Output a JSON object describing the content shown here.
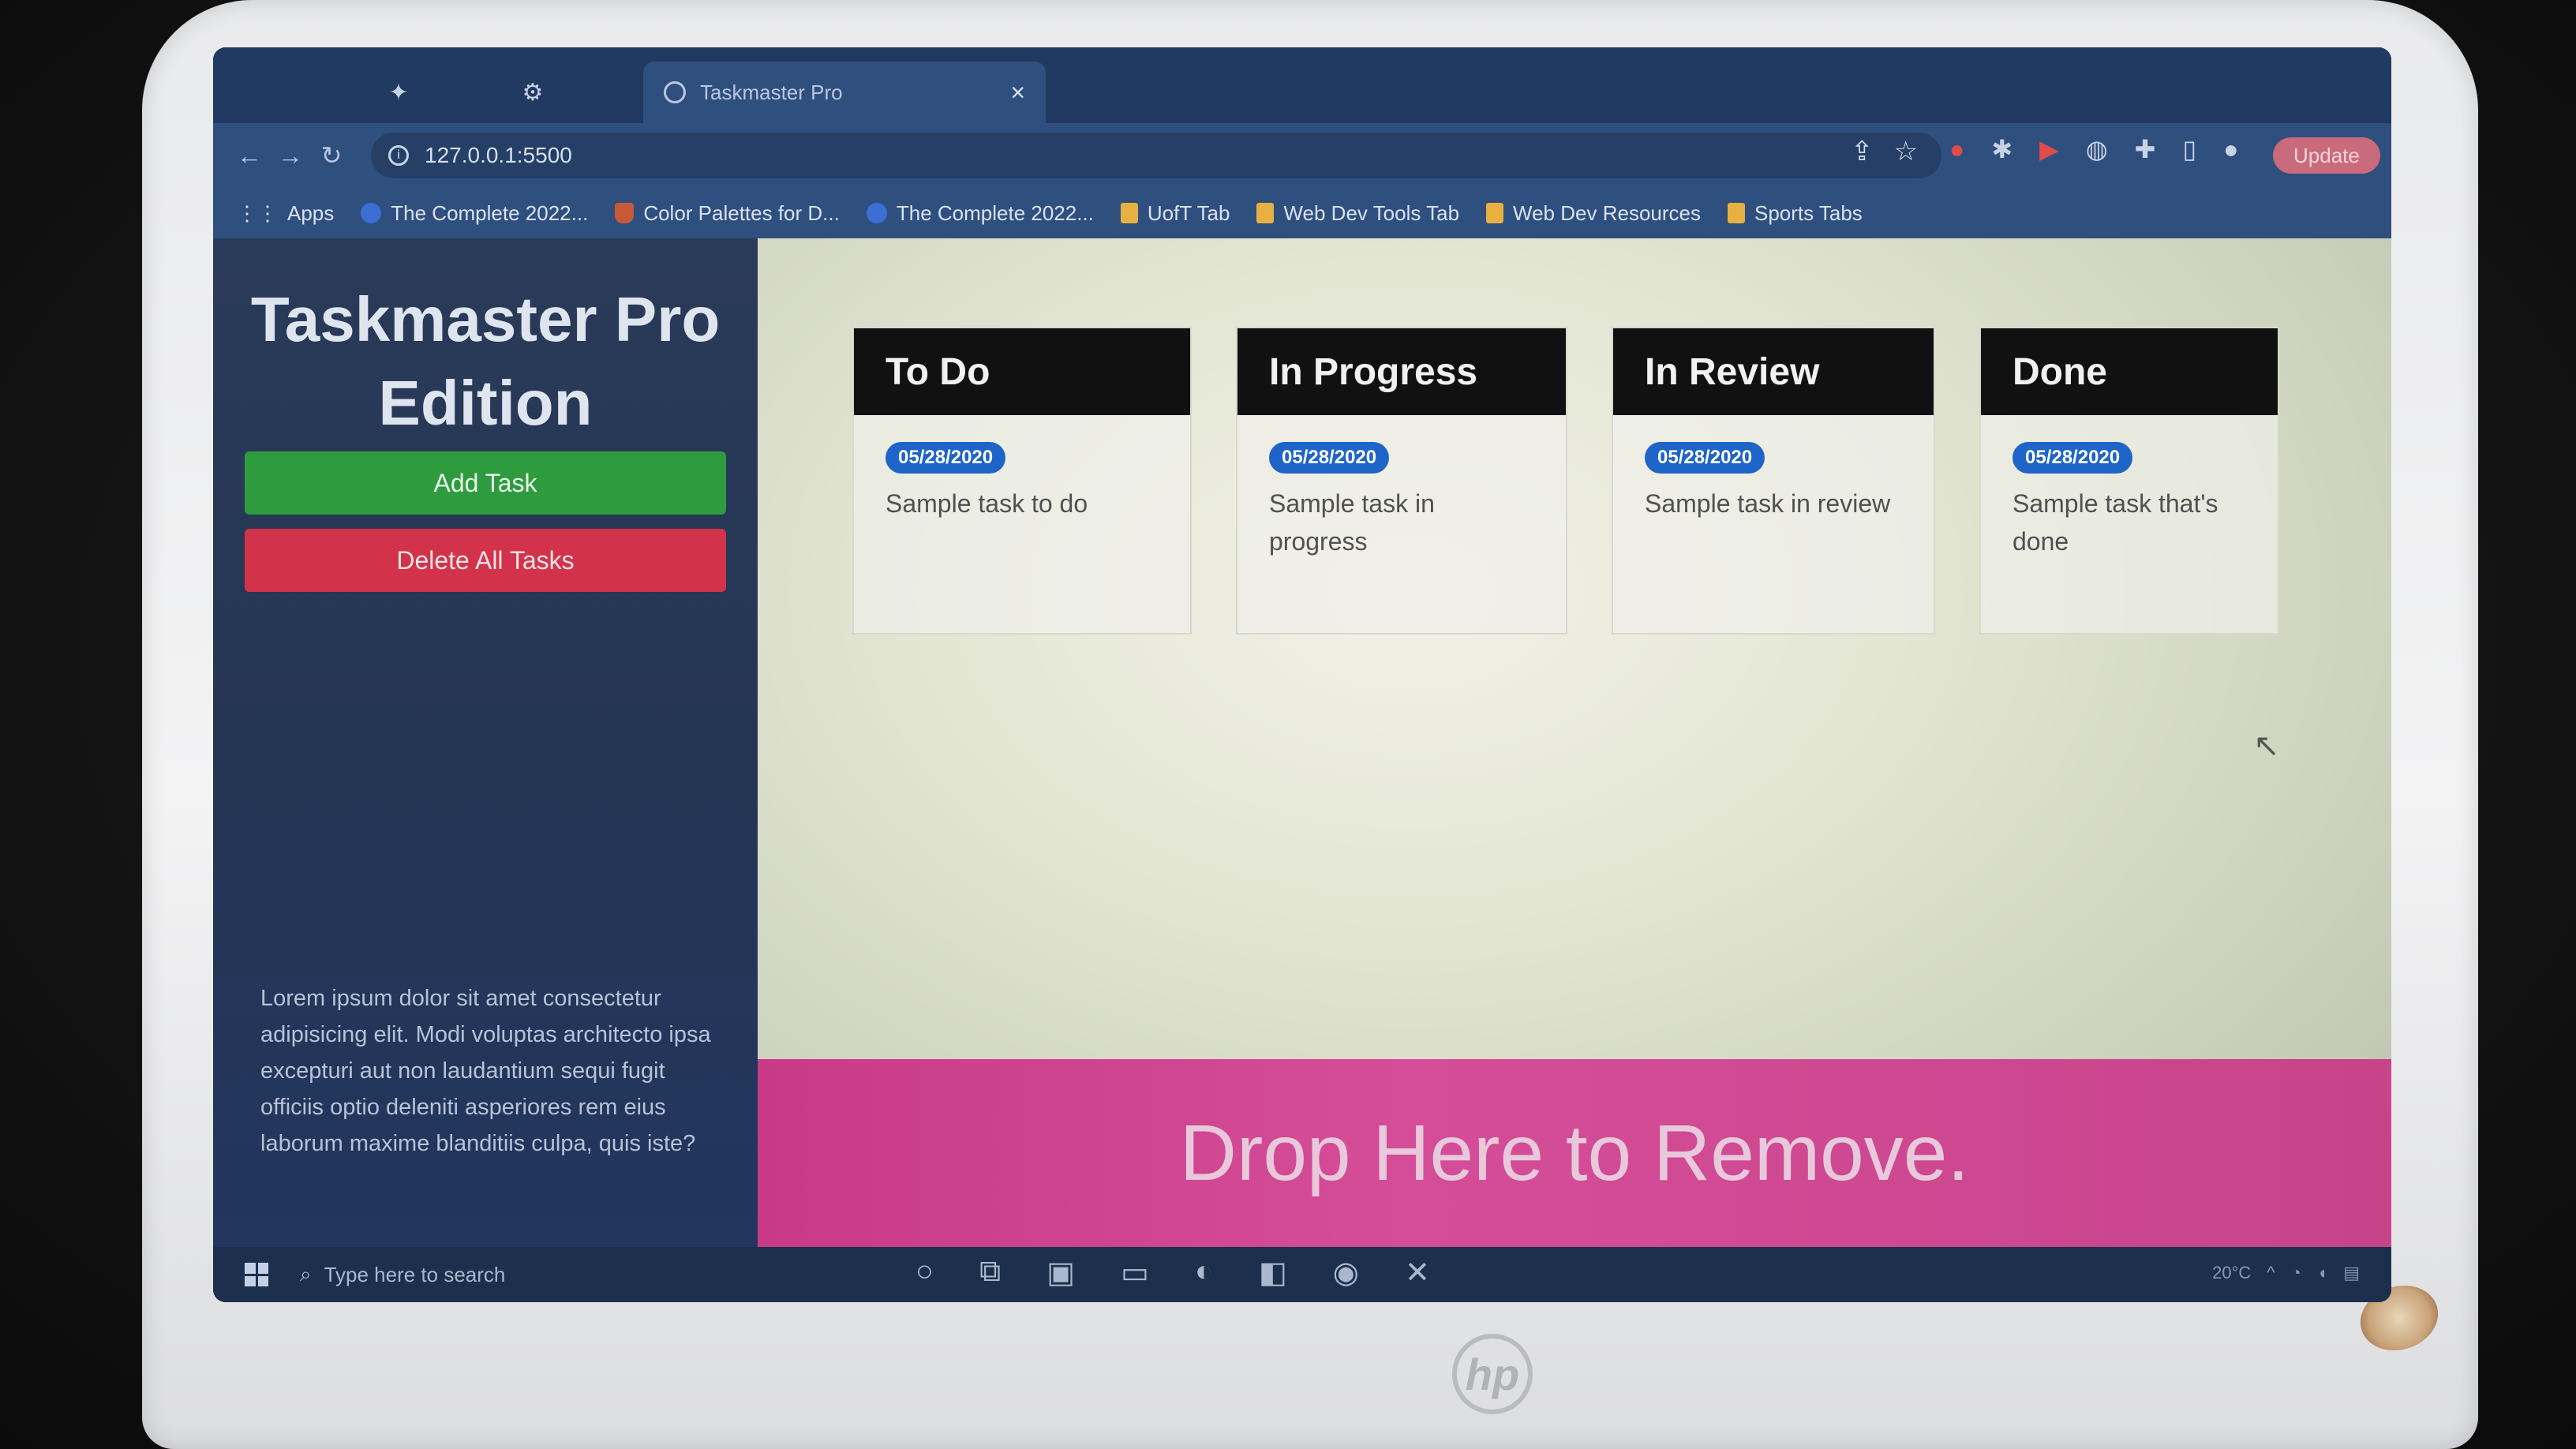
{
  "browser": {
    "active_tab_title": "Taskmaster Pro",
    "address": "127.0.0.1:5500",
    "update_label": "Update",
    "bookmarks": [
      {
        "label": "Apps"
      },
      {
        "label": "The Complete 2022..."
      },
      {
        "label": "Color Palettes for D..."
      },
      {
        "label": "The Complete 2022..."
      },
      {
        "label": "UofT Tab"
      },
      {
        "label": "Web Dev Tools Tab"
      },
      {
        "label": "Web Dev Resources"
      },
      {
        "label": "Sports Tabs"
      }
    ]
  },
  "app": {
    "title": "Taskmaster Pro Edition",
    "add_task_label": "Add Task",
    "delete_all_label": "Delete All Tasks",
    "sidebar_text": "Lorem ipsum dolor sit amet consectetur adipisicing elit. Modi voluptas architecto ipsa excepturi aut non laudantium sequi fugit officiis optio deleniti asperiores rem eius laborum maxime blanditiis culpa, quis iste?"
  },
  "columns": [
    {
      "title": "To Do",
      "tasks": [
        {
          "date": "05/28/2020",
          "text": "Sample task to do"
        }
      ]
    },
    {
      "title": "In Progress",
      "tasks": [
        {
          "date": "05/28/2020",
          "text": "Sample task in progress"
        }
      ]
    },
    {
      "title": "In Review",
      "tasks": [
        {
          "date": "05/28/2020",
          "text": "Sample task in review"
        }
      ]
    },
    {
      "title": "Done",
      "tasks": [
        {
          "date": "05/28/2020",
          "text": "Sample task that's done"
        }
      ]
    }
  ],
  "trash_label": "Drop Here to Remove.",
  "taskbar": {
    "search_placeholder": "Type here to search",
    "weather": "20°C"
  },
  "colors": {
    "add_button": "#2f9b3f",
    "delete_button": "#d3334a",
    "badge": "#1f64c8",
    "trash_zone": "#c93a86",
    "column_header": "#111111"
  }
}
